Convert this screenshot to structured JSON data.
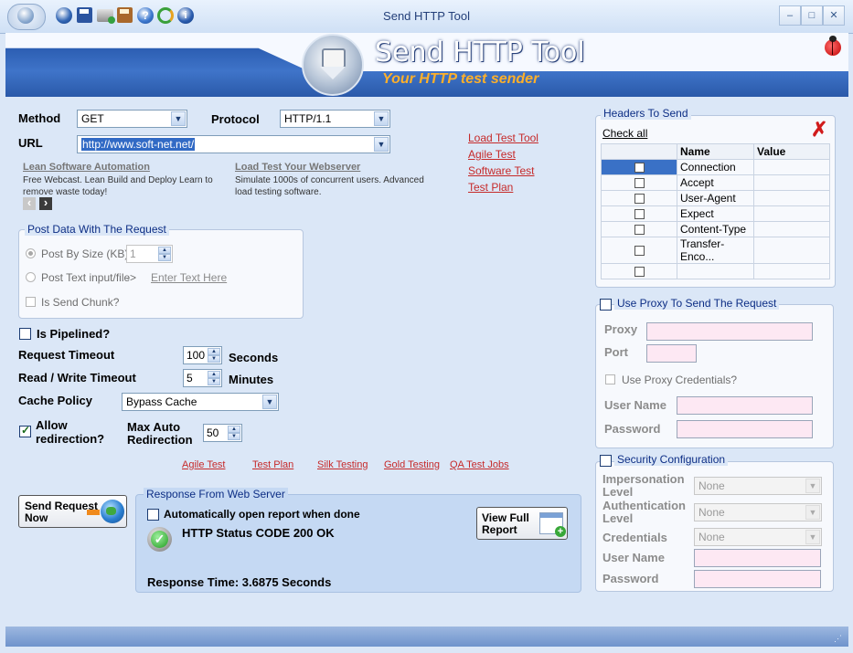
{
  "window": {
    "title": "Send HTTP Tool",
    "min": "–",
    "max": "□",
    "close": "✕"
  },
  "banner": {
    "title": "Send HTTP Tool",
    "subtitle": "Your HTTP test sender"
  },
  "form": {
    "method_label": "Method",
    "method_value": "GET",
    "protocol_label": "Protocol",
    "protocol_value": "HTTP/1.1",
    "url_label": "URL",
    "url_value": "http://www.soft-net.net/"
  },
  "ads": {
    "ad1_title": "Lean Software Automation",
    "ad1_text": "Free Webcast. Lean Build and Deploy Learn to remove waste today!",
    "ad2_title": "Load Test Your Webserver",
    "ad2_text": "Simulate 1000s of concurrent users. Advanced load testing software.",
    "prev": "‹",
    "next": "›"
  },
  "links_right": [
    "Load Test Tool",
    "Agile Test",
    "Software Test",
    "Test Plan"
  ],
  "post": {
    "legend": "Post Data With The Request",
    "by_size": "Post By Size (KB)",
    "size_value": "1",
    "text_file": "Post Text input/file",
    "arrow": "->",
    "enter_text": "Enter Text Here",
    "chunk": "Is Send Chunk?"
  },
  "options": {
    "pipelined": "Is Pipelined?",
    "req_timeout_label": "Request Timeout",
    "req_timeout_value": "100",
    "req_timeout_unit": "Seconds",
    "rw_timeout_label": "Read / Write Timeout",
    "rw_timeout_value": "5",
    "rw_timeout_unit": "Minutes",
    "cache_label": "Cache Policy",
    "cache_value": "Bypass Cache",
    "allow_redir_1": "Allow",
    "allow_redir_2": "redirection?",
    "max_redir_1": "Max Auto",
    "max_redir_2": "Redirection",
    "max_redir_value": "50"
  },
  "bottom_links": [
    "Agile Test",
    "Test Plan",
    "Silk Testing",
    "Gold Testing",
    "QA Test Jobs"
  ],
  "send": {
    "line1": "Send Request",
    "line2": "Now"
  },
  "response": {
    "legend": "Response From Web Server",
    "auto_open": "Automatically open report when done",
    "status": "HTTP Status CODE 200 OK",
    "time": "Response Time: 3.6875 Seconds",
    "view_1": "View Full",
    "view_2": "Report"
  },
  "headers": {
    "legend": "Headers To Send",
    "check_all": "Check all",
    "col_name": "Name",
    "col_value": "Value",
    "rows": [
      "Connection",
      "Accept",
      "User-Agent",
      "Expect",
      "Content-Type",
      "Transfer-Enco..."
    ]
  },
  "proxy": {
    "legend": "Use Proxy To Send The Request",
    "proxy_label": "Proxy",
    "port_label": "Port",
    "creds": "Use Proxy Credentials?",
    "user_label": "User Name",
    "pass_label": "Password"
  },
  "security": {
    "legend": "Security Configuration",
    "imp_1": "Impersonation",
    "imp_2": "Level",
    "imp_value": "None",
    "auth_1": "Authentication",
    "auth_2": "Level",
    "auth_value": "None",
    "cred_label": "Credentials",
    "cred_value": "None",
    "user_label": "User Name",
    "pass_label": "Password"
  },
  "colors": {
    "accent": "#0d2e85",
    "link": "#c62a2a",
    "banner": "#2a59a9",
    "pink_field": "#fde8f3"
  }
}
